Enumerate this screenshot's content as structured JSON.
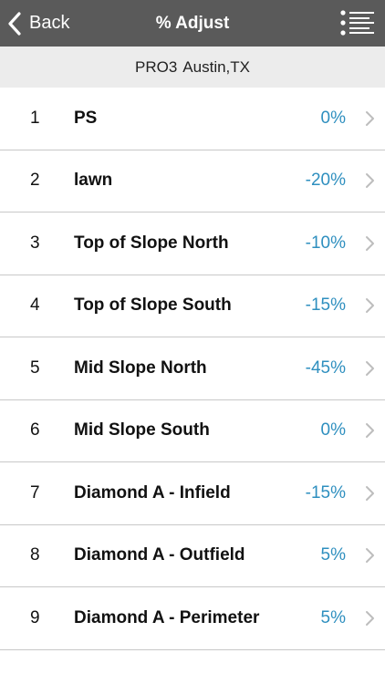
{
  "navbar": {
    "back_label": "Back",
    "title": "% Adjust",
    "menu_icon": "list-menu-icon"
  },
  "subheader": {
    "controller": "PRO3",
    "location": "Austin,TX"
  },
  "colors": {
    "navbar_bg": "#5a5a5a",
    "subheader_bg": "#ececec",
    "percent_accent": "#2e8fbf"
  },
  "zones": [
    {
      "number": "1",
      "name": "PS",
      "percent": "0%"
    },
    {
      "number": "2",
      "name": "lawn",
      "percent": "-20%"
    },
    {
      "number": "3",
      "name": "Top of Slope North",
      "percent": "-10%"
    },
    {
      "number": "4",
      "name": "Top of Slope South",
      "percent": "-15%"
    },
    {
      "number": "5",
      "name": "Mid Slope North",
      "percent": "-45%"
    },
    {
      "number": "6",
      "name": "Mid Slope South",
      "percent": "0%"
    },
    {
      "number": "7",
      "name": "Diamond A - Infield",
      "percent": "-15%"
    },
    {
      "number": "8",
      "name": "Diamond A - Outfield",
      "percent": "5%"
    },
    {
      "number": "9",
      "name": "Diamond A - Perimeter",
      "percent": "5%"
    }
  ]
}
